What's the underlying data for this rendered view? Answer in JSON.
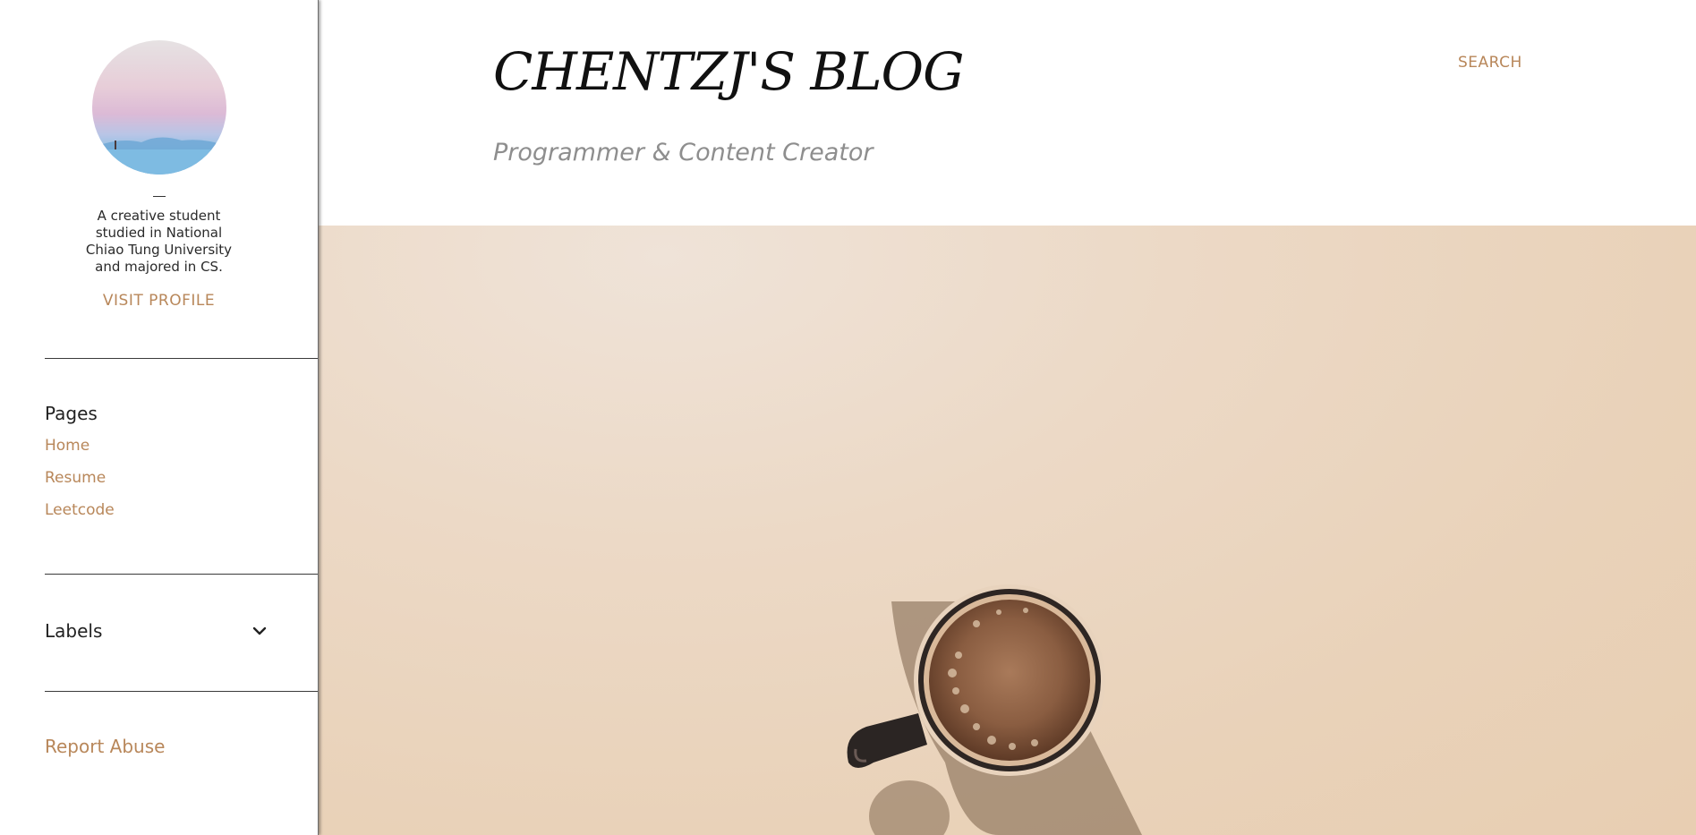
{
  "sidebar": {
    "profile": {
      "about": "A creative student studied in National Chiao Tung University and majored in CS.",
      "visit_profile_label": "VISIT PROFILE"
    },
    "pages": {
      "title": "Pages",
      "items": [
        {
          "label": "Home"
        },
        {
          "label": "Resume"
        },
        {
          "label": "Leetcode"
        }
      ]
    },
    "labels": {
      "title": "Labels",
      "toggle_icon": "chevron-down-icon"
    },
    "report_abuse_label": "Report Abuse"
  },
  "header": {
    "title": "CHENTZJ'S BLOG",
    "subtitle": "Programmer & Content Creator",
    "search_label": "SEARCH"
  },
  "colors": {
    "accent": "#b8875a",
    "title_text": "#111111",
    "subtitle_text": "#8e8e8e",
    "hero_background": "#e9d2b9"
  }
}
